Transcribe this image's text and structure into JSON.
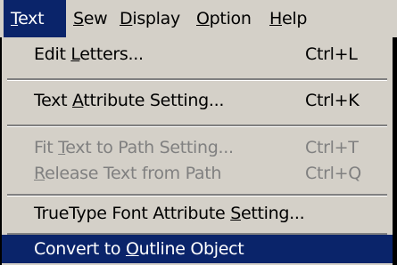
{
  "menubar": {
    "items": [
      {
        "pre": "",
        "u": "T",
        "post": "ext"
      },
      {
        "pre": "",
        "u": "S",
        "post": "ew"
      },
      {
        "pre": "",
        "u": "D",
        "post": "isplay"
      },
      {
        "pre": "",
        "u": "O",
        "post": "ption"
      },
      {
        "pre": "",
        "u": "H",
        "post": "elp"
      }
    ]
  },
  "menu": {
    "items": [
      {
        "pre": "Edit ",
        "u": "L",
        "post": "etters...",
        "shortcut": "Ctrl+L"
      },
      {
        "pre": "Text ",
        "u": "A",
        "post": "ttribute Setting...",
        "shortcut": "Ctrl+K"
      },
      {
        "pre": "Fit ",
        "u": "T",
        "post": "ext to Path Setting...",
        "shortcut": "Ctrl+T"
      },
      {
        "pre": "",
        "u": "R",
        "post": "elease Text from Path",
        "shortcut": "Ctrl+Q"
      },
      {
        "pre": "TrueType Font Attribute ",
        "u": "S",
        "post": "etting...",
        "shortcut": ""
      },
      {
        "pre": "Convert to ",
        "u": "O",
        "post": "utline Object",
        "shortcut": ""
      }
    ]
  },
  "colors": {
    "face": "#d4d0c8",
    "highlight": "#0a246a",
    "disabled_text": "#808080"
  }
}
